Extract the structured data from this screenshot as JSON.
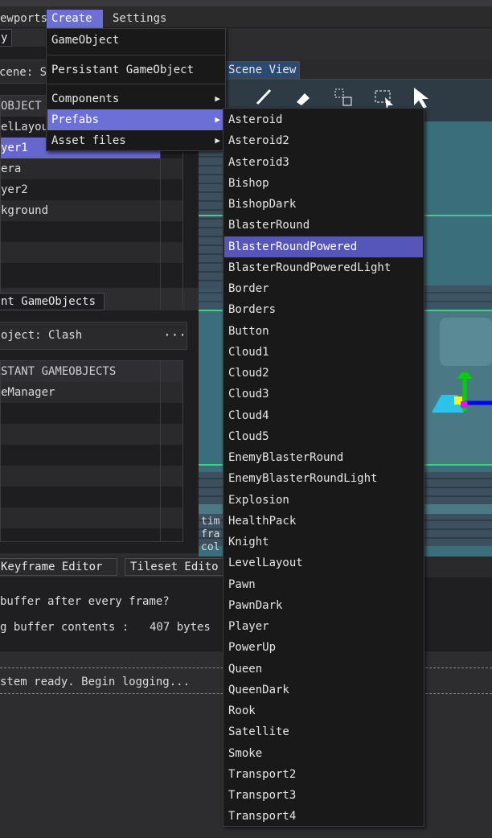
{
  "menubar": {
    "items": [
      "ewports",
      "Create",
      "Settings"
    ]
  },
  "left": {
    "top_tab": "y",
    "scene_label": "cene: S",
    "list_header": " OBJECT",
    "objects": [
      "elLayou",
      "yer1",
      "era",
      "yer2",
      "kground"
    ],
    "persistant_tab": "nt GameObjects",
    "project_label": "oject: Clash",
    "project_menu": "···",
    "persistant_header": "STANT GAMEOBJECTS",
    "persistant_items": [
      "eManager"
    ]
  },
  "bottom": {
    "tabs": [
      "Keyframe Editor",
      "Tileset Edito"
    ],
    "buffer_question": "buffer after every frame?",
    "buffer_label": "g buffer contents :",
    "buffer_value": "407 bytes",
    "log_line": "stem ready. Begin logging..."
  },
  "scene": {
    "tab": "Scene View",
    "overlay_lines": [
      "tim",
      "fra",
      "col"
    ]
  },
  "create_menu": {
    "items": [
      "GameObject",
      "Persistant GameObject",
      "Components",
      "Prefabs",
      "Asset files"
    ]
  },
  "prefabs_menu": {
    "items": [
      "Asteroid",
      "Asteroid2",
      "Asteroid3",
      "Bishop",
      "BishopDark",
      "BlasterRound",
      "BlasterRoundPowered",
      "BlasterRoundPoweredLight",
      "Border",
      "Borders",
      "Button",
      "Cloud1",
      "Cloud2",
      "Cloud3",
      "Cloud4",
      "Cloud5",
      "EnemyBlasterRound",
      "EnemyBlasterRoundLight",
      "Explosion",
      "HealthPack",
      "Knight",
      "LevelLayout",
      "Pawn",
      "PawnDark",
      "Player",
      "PowerUp",
      "Queen",
      "QueenDark",
      "Rook",
      "Satellite",
      "Smoke",
      "Transport2",
      "Transport3",
      "Transport4"
    ],
    "highlighted": "BlasterRoundPowered"
  },
  "colors": {
    "accent": "#6b6fd6",
    "selection": "#6666cc",
    "scene_bg": "#3a6e7a",
    "gizmo_green": "#00d000",
    "gizmo_blue": "#0000ff"
  }
}
